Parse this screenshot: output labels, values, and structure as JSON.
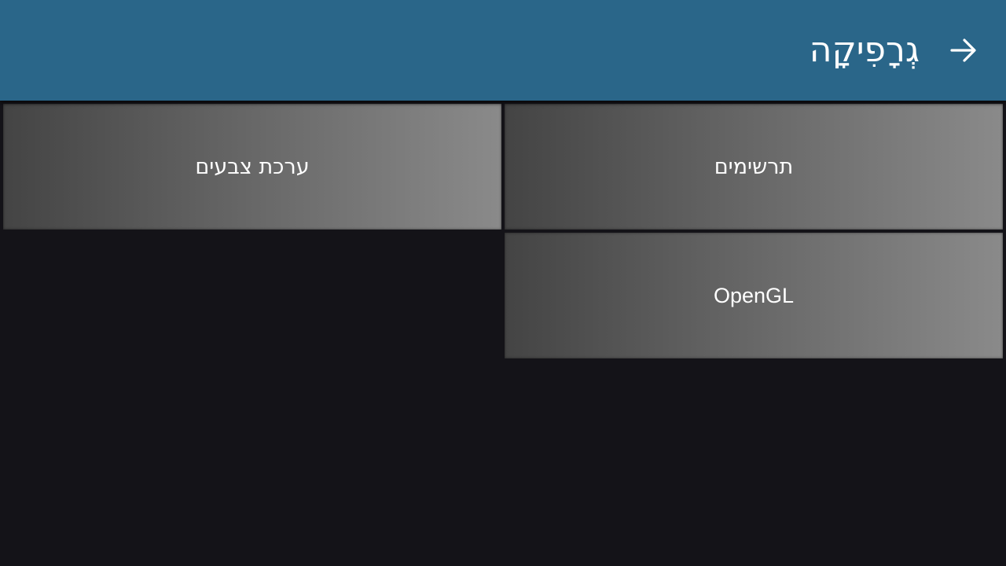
{
  "header": {
    "title": "גְרָפִיקָה",
    "back_icon": "arrow-right-icon",
    "background": "#2a6689"
  },
  "tiles": [
    {
      "label": "תרשימים"
    },
    {
      "label": "ערכת צבעים"
    },
    {
      "label": "OpenGL"
    }
  ],
  "colors": {
    "background": "#141318",
    "tile_gradient_start": "#444444",
    "tile_gradient_end": "#8a8a8a",
    "text": "#ffffff"
  }
}
